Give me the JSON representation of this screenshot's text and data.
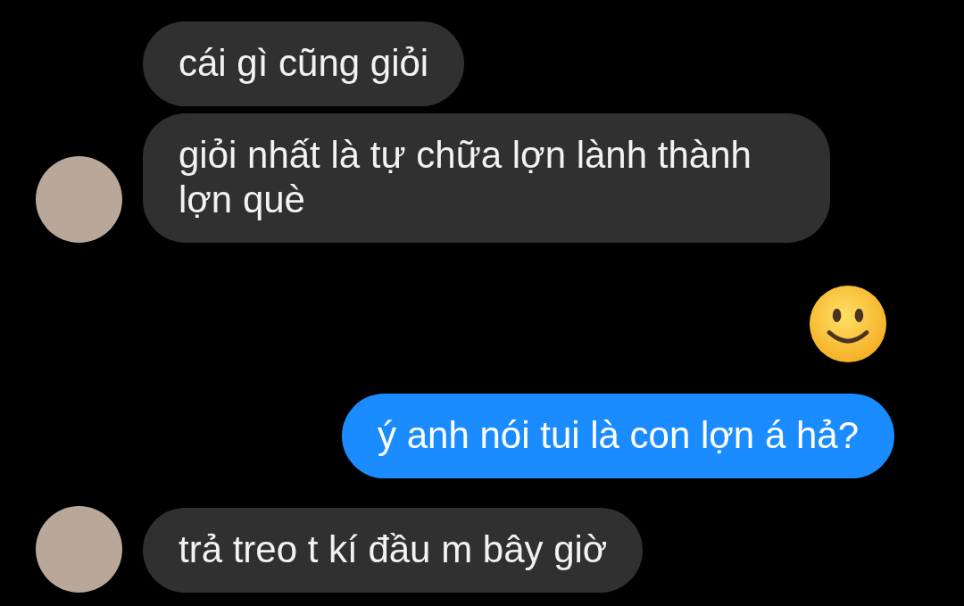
{
  "messages": [
    {
      "outgoing": false,
      "kind": "text",
      "text": "cái gì cũng giỏi",
      "avatar": false
    },
    {
      "outgoing": false,
      "kind": "text",
      "text": "giỏi nhất là tự chữa lợn lành thành lợn què",
      "avatar": true
    },
    {
      "outgoing": true,
      "kind": "emoji"
    },
    {
      "outgoing": true,
      "kind": "text",
      "text": "ý anh nói tui là con lợn á hả?"
    },
    {
      "outgoing": false,
      "kind": "text",
      "text": "trả treo t kí đầu m bây giờ",
      "avatar": true
    }
  ]
}
